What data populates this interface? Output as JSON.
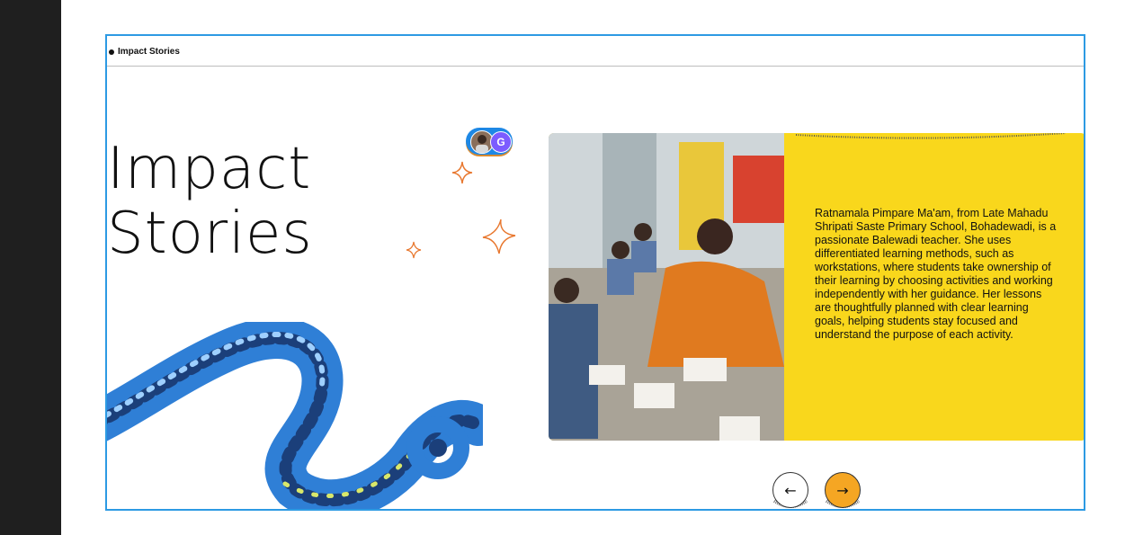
{
  "section": {
    "label": "Impact Stories"
  },
  "hero": {
    "line1": "Impact",
    "line2": "Stories"
  },
  "avatars": {
    "letter": "G",
    "letter_color": "#7c5cff",
    "pill_color": "#1e88e5"
  },
  "story": {
    "text": "Ratnamala Pimpare Ma'am, from Late Mahadu Shripati Saste Primary School, Bohadewadi, is a passionate Balewadi teacher. She uses differentiated learning methods, such as workstations, where students take ownership of their learning by choosing activities and working independently with her guidance. Her lessons are thoughtfully planned with clear learning goals, helping students stay focused and understand the purpose of each activity.",
    "card_color": "#f9d71c"
  },
  "nav": {
    "prev_icon": "←",
    "next_icon": "→",
    "next_color": "#f5a623"
  },
  "colors": {
    "frame_border": "#2d9ae3",
    "sidebar": "#1f1f1f",
    "sparkle": "#e8772e",
    "swirl": "#2f7fd6"
  },
  "icons": [
    "sparkle-icon",
    "arrow-left-icon",
    "arrow-right-icon"
  ]
}
